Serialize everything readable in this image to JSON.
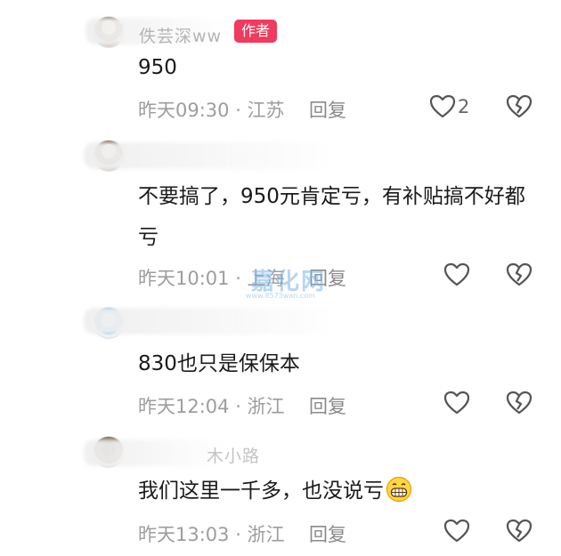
{
  "comments": [
    {
      "username": "佚芸深ww",
      "badge": "作者",
      "text": "950",
      "meta": "昨天09:30 · 江苏",
      "reply_label": "回复",
      "like_count": "2"
    },
    {
      "username": "",
      "badge": "",
      "text": "不要搞了，950元肯定亏，有补贴搞不好都亏",
      "meta": "昨天10:01 · 上海",
      "reply_label": "回复",
      "like_count": ""
    },
    {
      "username": "",
      "badge": "",
      "text": "830也只是保保本",
      "meta": "昨天12:04 · 浙江",
      "reply_label": "回复",
      "like_count": ""
    },
    {
      "username": "木小路",
      "badge": "",
      "text": "我们这里一千多，也没说亏",
      "meta": "昨天13:03 · 浙江",
      "reply_label": "回复",
      "like_count": ""
    }
  ],
  "watermark": {
    "logo": "嘉化网",
    "url": "www.8573wan.com"
  },
  "icons": {
    "like": "heart-outline-icon",
    "dislike": "broken-heart-icon",
    "emoji": "grinning-face-icon"
  }
}
